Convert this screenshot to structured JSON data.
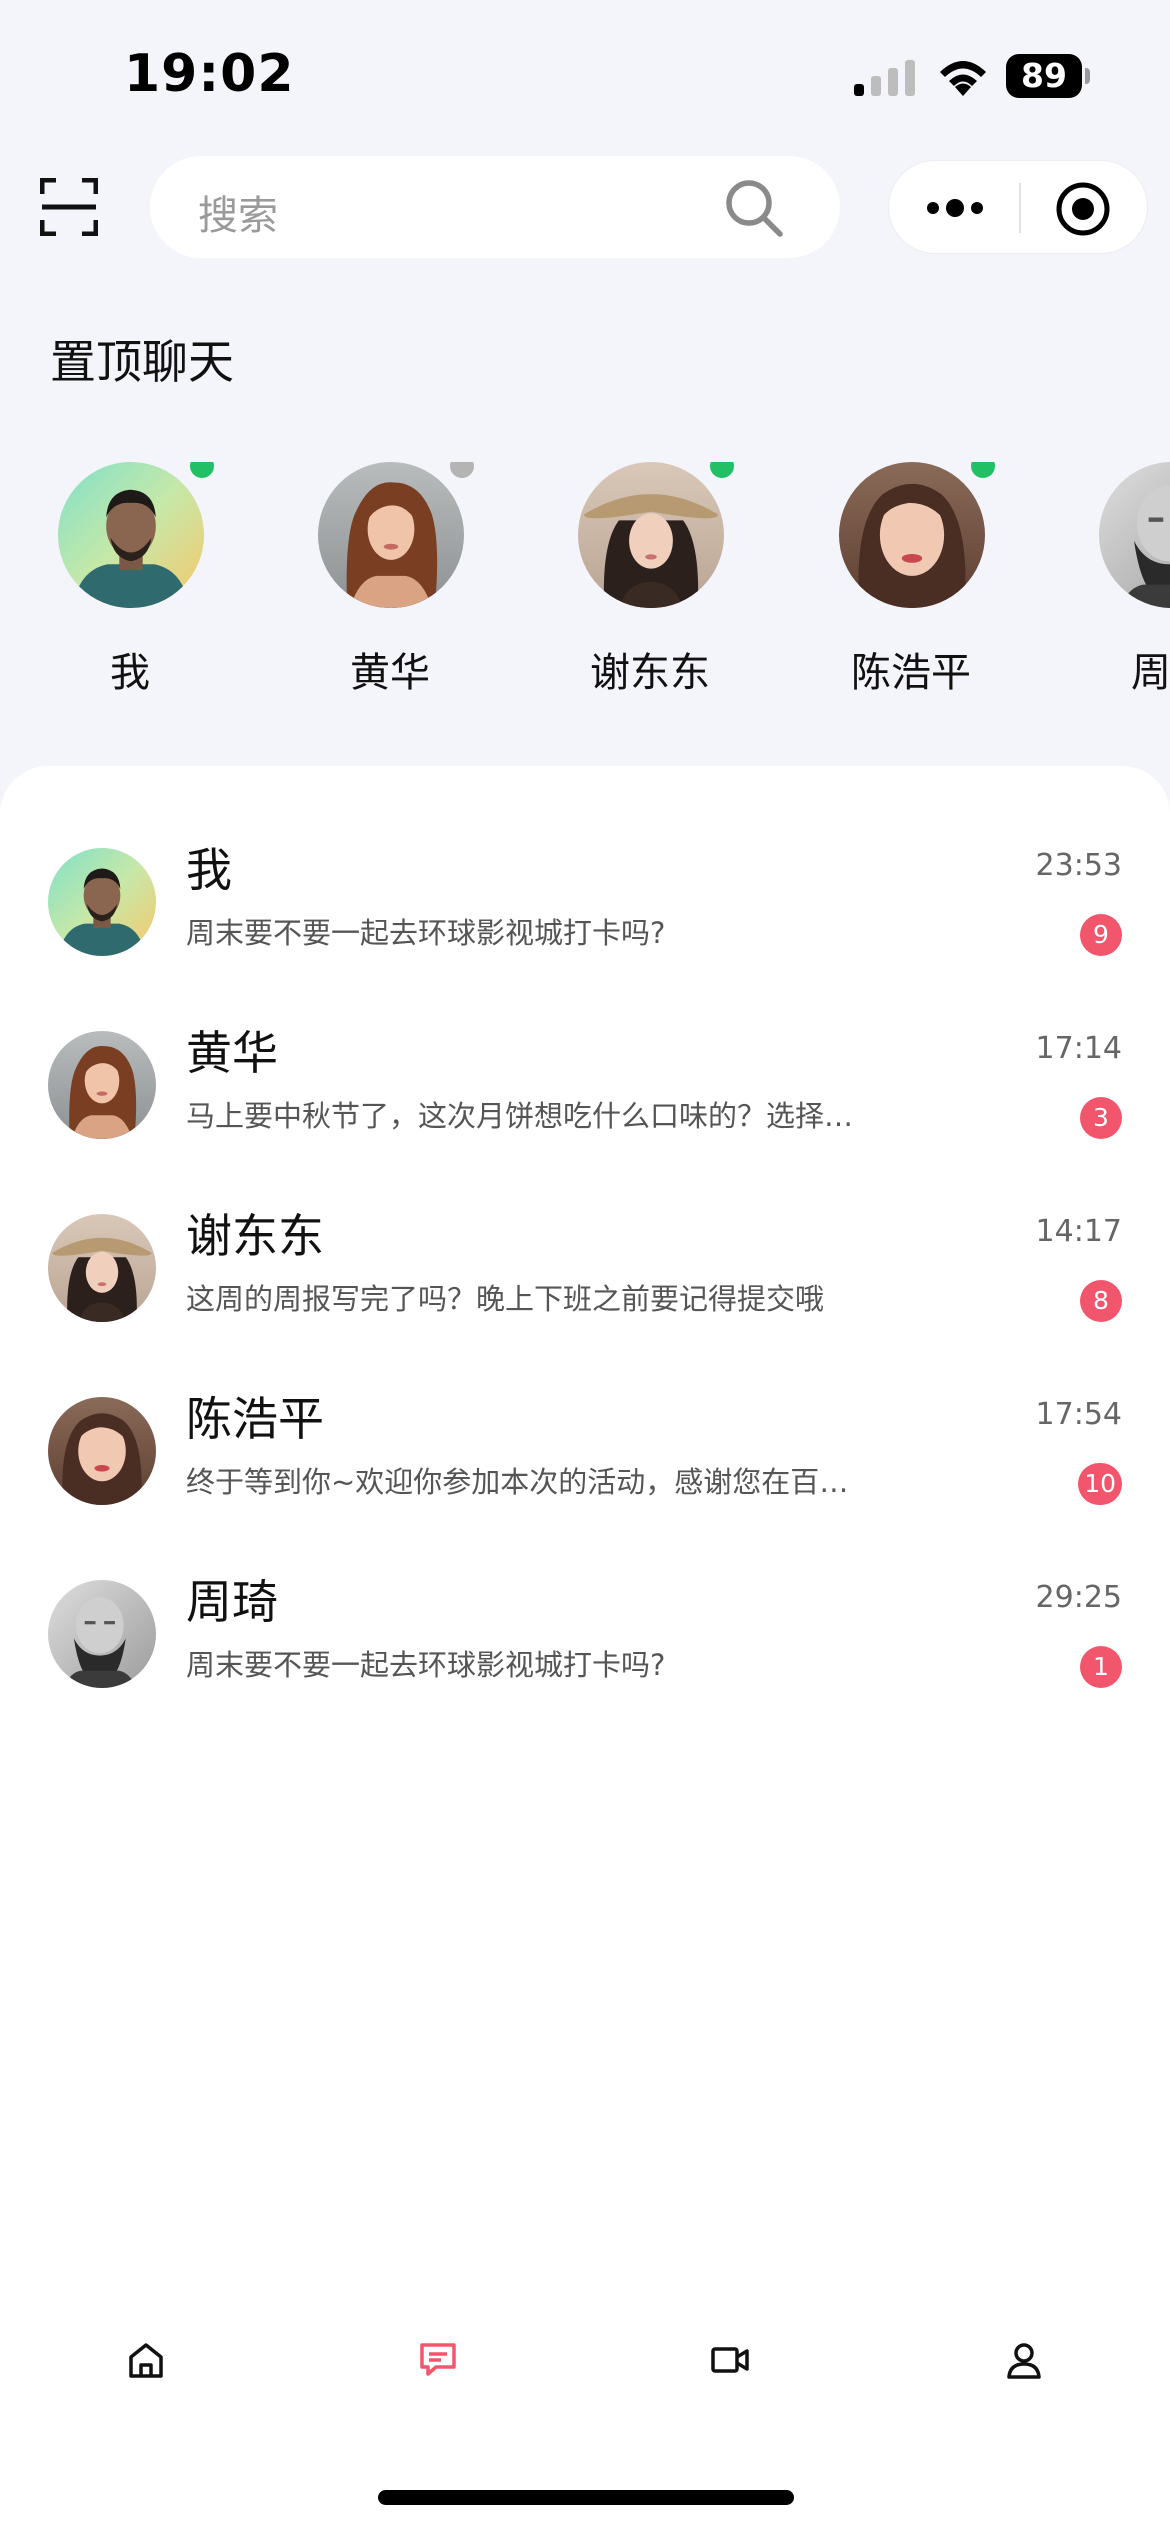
{
  "status_bar": {
    "time": "19:02",
    "battery": "89",
    "icons": [
      "cellular-signal-icon",
      "wifi-icon",
      "battery-icon"
    ]
  },
  "top_bar": {
    "search_placeholder": "搜索",
    "icons": [
      "scan-icon",
      "search-icon",
      "more-icon",
      "close-mini-program-icon"
    ]
  },
  "pinned": {
    "title": "置顶聊天",
    "items": [
      {
        "name": "我",
        "online": true
      },
      {
        "name": "黄华",
        "online": false
      },
      {
        "name": "谢东东",
        "online": true
      },
      {
        "name": "陈浩平",
        "online": true
      },
      {
        "name": "周"
      }
    ]
  },
  "chats": [
    {
      "name": "我",
      "preview": "周末要不要一起去环球影视城打卡吗?",
      "time": "23:53",
      "unread": "9"
    },
    {
      "name": "黄华",
      "preview": "马上要中秋节了，这次月饼想吃什么口味的？选择困难症又犯了",
      "time": "17:14",
      "unread": "3"
    },
    {
      "name": "谢东东",
      "preview": "这周的周报写完了吗？晚上下班之前要记得提交哦",
      "time": "14:17",
      "unread": "8"
    },
    {
      "name": "陈浩平",
      "preview": "终于等到你~欢迎你参加本次的活动，感谢您在百忙之中抽空参加",
      "time": "17:54",
      "unread": "10"
    },
    {
      "name": "周琦",
      "preview": "周末要不要一起去环球影视城打卡吗?",
      "time": "29:25",
      "unread": "1"
    }
  ],
  "tab_bar": {
    "tabs": [
      {
        "icon": "home-icon",
        "active": false
      },
      {
        "icon": "chat-icon",
        "active": true
      },
      {
        "icon": "video-icon",
        "active": false
      },
      {
        "icon": "user-icon",
        "active": false
      }
    ]
  },
  "colors": {
    "background": "#f4f4fb",
    "accent": "#f2566d",
    "online": "#22c064",
    "offline": "#b4b4b4",
    "badge": "#f2566d"
  }
}
